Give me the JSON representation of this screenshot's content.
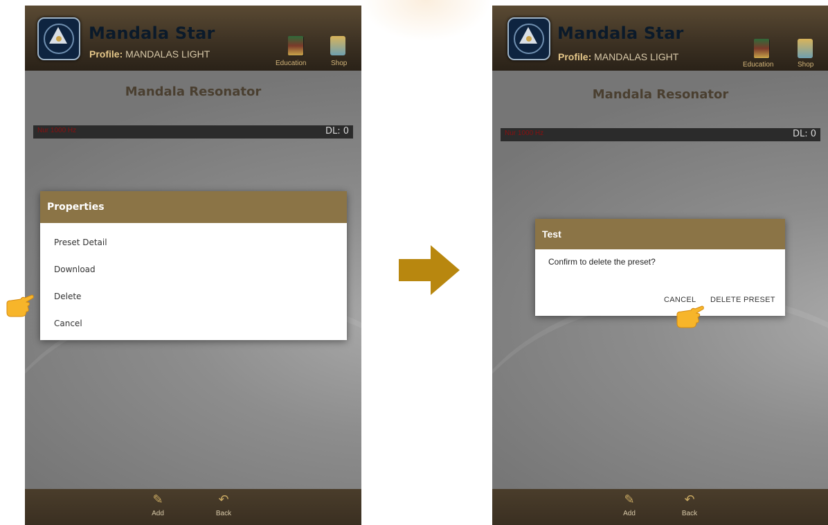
{
  "left_screen": {
    "app_title": "Mandala Star",
    "profile_label": "Profile:",
    "profile_name": "MANDALAS LIGHT",
    "toolbar": {
      "education_label": "Education",
      "shop_label": "Shop"
    },
    "heading": "Mandala Resonator",
    "status_bar": {
      "left_text": "Nur 1000 Hz",
      "right_text": "DL: 0"
    },
    "dialog": {
      "title": "Properties",
      "items": [
        "Preset Detail",
        "Download",
        "Delete",
        "Cancel"
      ]
    },
    "bottom_bar": {
      "add_label": "Add",
      "back_label": "Back"
    }
  },
  "right_screen": {
    "app_title": "Mandala Star",
    "profile_label": "Profile:",
    "profile_name": "MANDALAS LIGHT",
    "toolbar": {
      "education_label": "Education",
      "shop_label": "Shop"
    },
    "heading": "Mandala Resonator",
    "status_bar": {
      "left_text": "Nur 1000 Hz",
      "right_text": "DL: 0"
    },
    "dialog": {
      "title": "Test",
      "message": "Confirm to delete the preset?",
      "cancel_label": "CANCEL",
      "confirm_label": "DELETE PRESET"
    },
    "bottom_bar": {
      "add_label": "Add",
      "back_label": "Back"
    }
  },
  "icons": {
    "arrow": "right-arrow-icon",
    "pointer": "pointing-hand-icon",
    "education": "books-icon",
    "shop": "cart-icon",
    "add": "pencil-icon",
    "back": "back-arrow-icon"
  },
  "colors": {
    "accent_gold": "#8b7446",
    "arrow": "#b8870f",
    "topbar": "#3b3022",
    "status_red": "#8a1010"
  }
}
